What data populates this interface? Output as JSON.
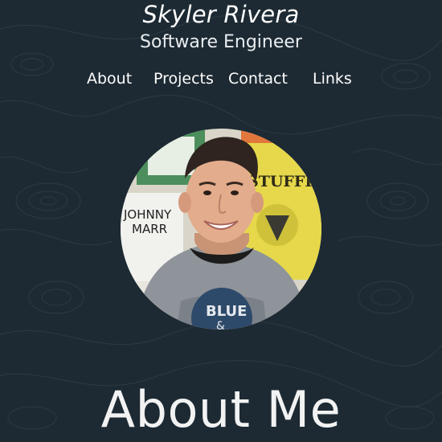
{
  "header": {
    "name": "Skyler Rivera",
    "role": "Software Engineer"
  },
  "nav": {
    "items": [
      "About",
      "Projects",
      "Contact",
      "Links"
    ]
  },
  "profile_photo": {
    "shirt_print_line1": "BLUE",
    "shirt_print_line2": "&",
    "poster_left_line1": "JOHNNY",
    "poster_left_line2": "MARR",
    "poster_right_line1": "STUFFING"
  },
  "about": {
    "heading": "About Me"
  },
  "colors": {
    "background": "#1d2a33",
    "text": "#ffffff",
    "topo_lines": "#2c3a44"
  }
}
